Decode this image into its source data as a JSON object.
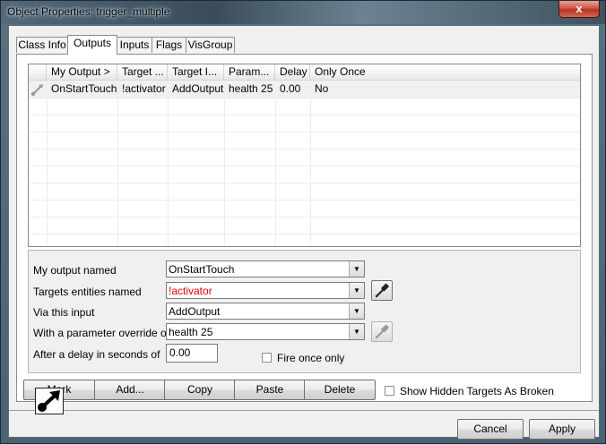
{
  "window": {
    "title": "Object Properties: trigger_multiple",
    "close_glyph": "x"
  },
  "tabs": [
    {
      "label": "Class Info",
      "active": false
    },
    {
      "label": "Outputs",
      "active": true
    },
    {
      "label": "Inputs",
      "active": false
    },
    {
      "label": "Flags",
      "active": false
    },
    {
      "label": "VisGroup",
      "active": false
    }
  ],
  "outputs_table": {
    "columns": [
      "My Output  >",
      "Target ...",
      "Target I...",
      "Param...",
      "Delay",
      "Only Once"
    ],
    "rows": [
      {
        "icon": "output-connection-icon",
        "my_output": "OnStartTouch",
        "target": "!activator",
        "target_input": "AddOutput",
        "param": "health 25",
        "delay": "0.00",
        "only_once": "No"
      }
    ]
  },
  "form": {
    "my_output_label": "My output named",
    "my_output_value": "OnStartTouch",
    "targets_label": "Targets entities named",
    "targets_value": "!activator",
    "targets_color": "#e00000",
    "via_input_label": "Via this input",
    "via_input_value": "AddOutput",
    "param_label": "With a parameter override of",
    "param_value": "health 25",
    "delay_label": "After a delay in seconds of",
    "delay_value": "0.00",
    "fire_once_label": "Fire once only",
    "fire_once_checked": false
  },
  "actions": {
    "mark": "Mark",
    "add": "Add...",
    "copy": "Copy",
    "paste": "Paste",
    "delete": "Delete",
    "show_hidden_label": "Show Hidden Targets As Broken",
    "show_hidden_checked": false
  },
  "footer": {
    "status_icon": "output-arrow-icon",
    "cancel": "Cancel",
    "apply": "Apply"
  }
}
